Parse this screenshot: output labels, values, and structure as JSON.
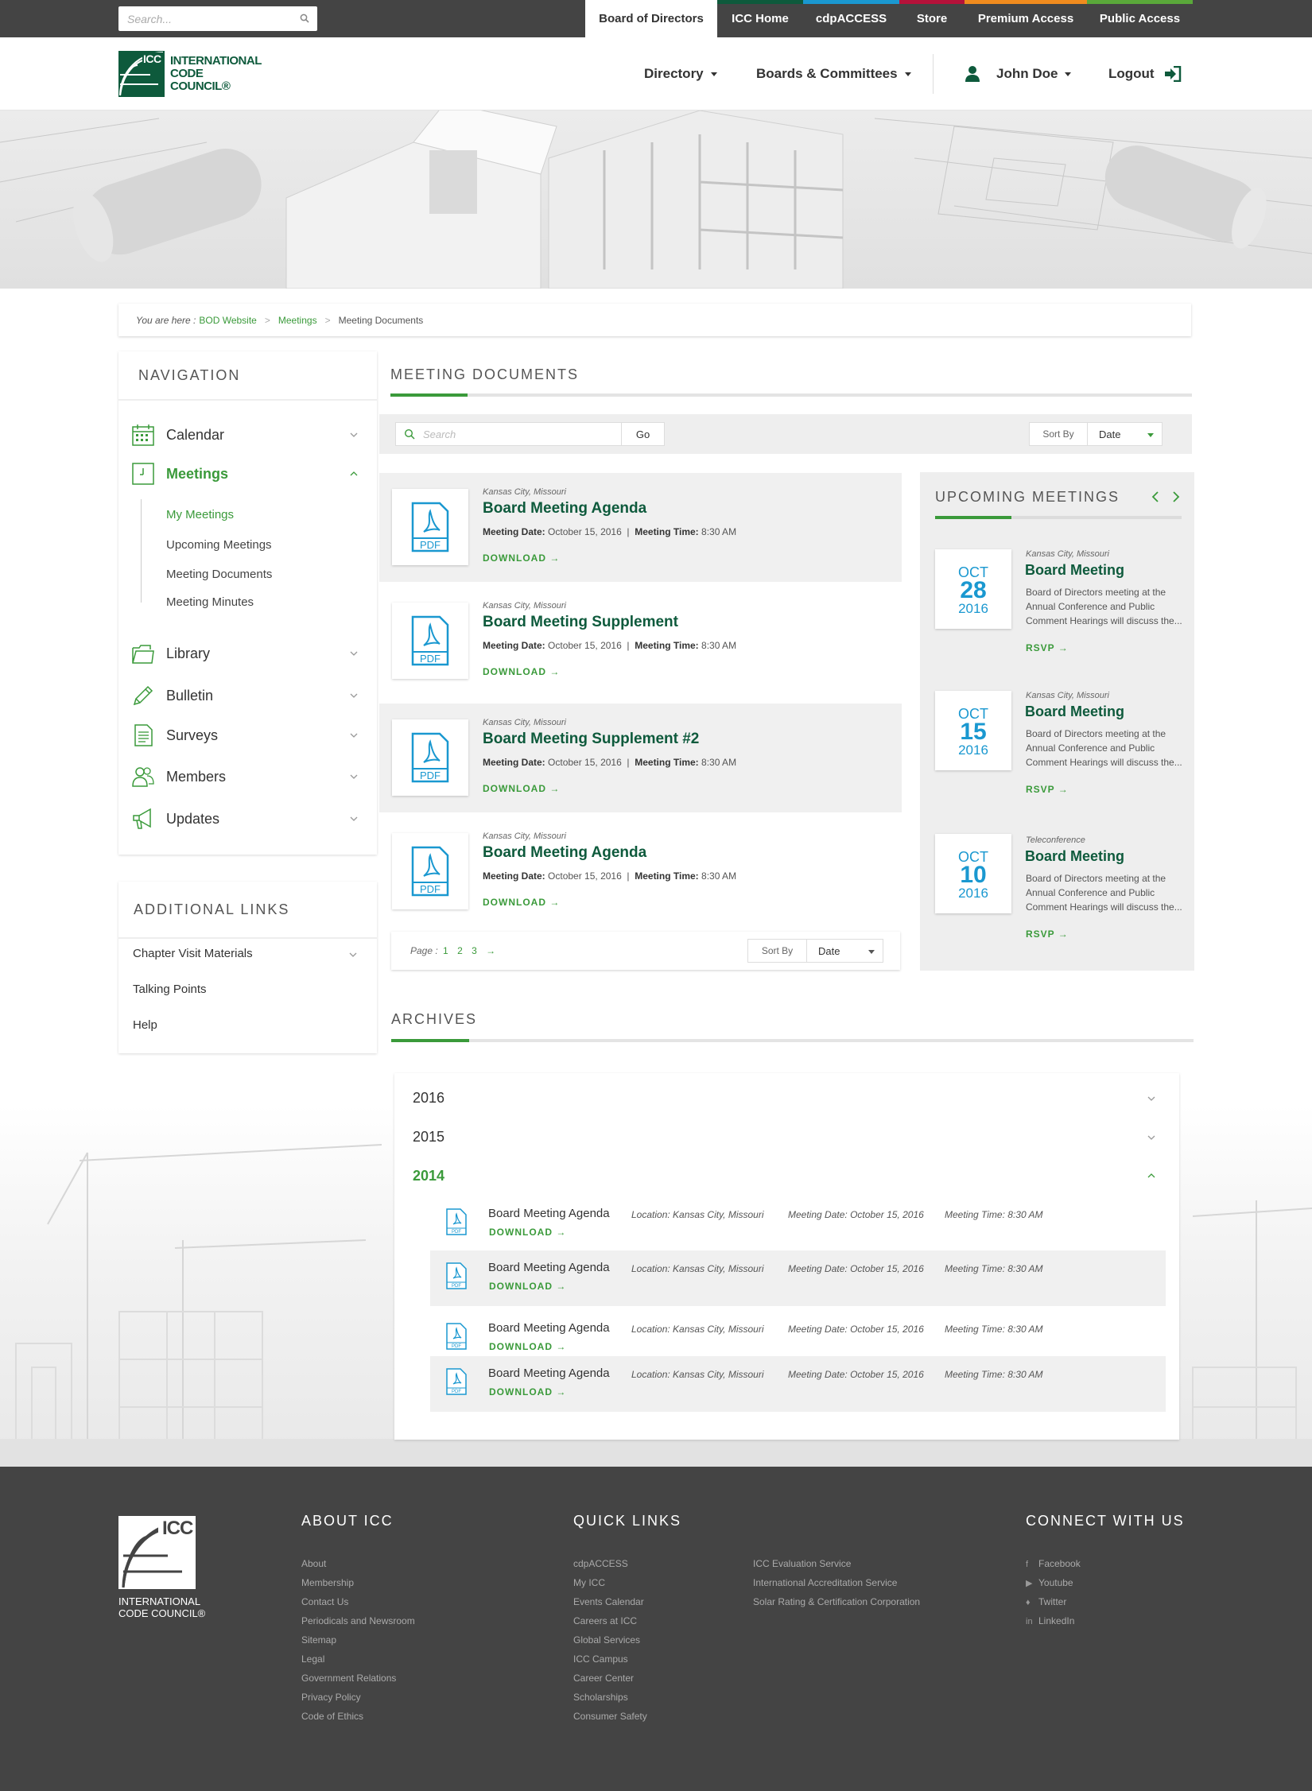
{
  "topbar": {
    "search_placeholder": "Search...",
    "tabs": [
      {
        "label": "Board of Directors",
        "accent": "#ffffff"
      },
      {
        "label": "ICC Home",
        "accent": "#0e5a3c"
      },
      {
        "label": "cdpACCESS",
        "accent": "#1a98d0"
      },
      {
        "label": "Store",
        "accent": "#b5123a"
      },
      {
        "label": "Premium Access",
        "accent": "#f08b1e"
      },
      {
        "label": "Public Access",
        "accent": "#5aa83a"
      }
    ]
  },
  "header": {
    "logo_text": [
      "INTERNATIONAL",
      "CODE",
      "COUNCIL®"
    ],
    "logo_abbr": "ICC",
    "nav": {
      "directory": "Directory",
      "boards": "Boards & Committees",
      "user": "John Doe",
      "logout": "Logout"
    }
  },
  "breadcrumb": {
    "prefix": "You are here :",
    "items": [
      "BOD Website",
      "Meetings",
      "Meeting Documents"
    ]
  },
  "sidebar": {
    "title": "NAVIGATION",
    "items": [
      {
        "label": "Calendar",
        "icon": "calendar-icon"
      },
      {
        "label": "Meetings",
        "icon": "clock-icon",
        "active": true
      },
      {
        "label": "Library",
        "icon": "folder-icon"
      },
      {
        "label": "Bulletin",
        "icon": "pencil-icon"
      },
      {
        "label": "Surveys",
        "icon": "document-icon"
      },
      {
        "label": "Members",
        "icon": "members-icon"
      },
      {
        "label": "Updates",
        "icon": "megaphone-icon"
      }
    ],
    "sub_items": [
      "My Meetings",
      "Upcoming Meetings",
      "Meeting Documents",
      "Meeting Minutes"
    ],
    "links_title": "ADDITIONAL LINKS",
    "links": [
      "Chapter Visit Materials",
      "Talking Points",
      "Help"
    ]
  },
  "main": {
    "title": "MEETING DOCUMENTS",
    "search_placeholder": "Search",
    "go_label": "Go",
    "sort_label": "Sort By",
    "sort_value": "Date",
    "documents": [
      {
        "location": "Kansas City, Missouri",
        "title": "Board Meeting Agenda",
        "date_label": "Meeting Date:",
        "date": "October 15, 2016",
        "time_label": "Meeting Time:",
        "time": "8:30 AM",
        "download": "DOWNLOAD →"
      },
      {
        "location": "Kansas City, Missouri",
        "title": "Board Meeting Supplement",
        "date_label": "Meeting Date:",
        "date": "October 15, 2016",
        "time_label": "Meeting Time:",
        "time": "8:30 AM",
        "download": "DOWNLOAD →"
      },
      {
        "location": "Kansas City, Missouri",
        "title": "Board Meeting Supplement #2",
        "date_label": "Meeting Date:",
        "date": "October 15, 2016",
        "time_label": "Meeting Time:",
        "time": "8:30 AM",
        "download": "DOWNLOAD →"
      },
      {
        "location": "Kansas City, Missouri",
        "title": "Board Meeting Agenda",
        "date_label": "Meeting Date:",
        "date": "October 15, 2016",
        "time_label": "Meeting Time:",
        "time": "8:30 AM",
        "download": "DOWNLOAD →"
      }
    ],
    "pdf_label": "PDF",
    "pager": {
      "label": "Page :",
      "pages": [
        "1",
        "2",
        "3"
      ],
      "next": "→"
    }
  },
  "upcoming": {
    "title": "UPCOMING MEETINGS",
    "events": [
      {
        "month": "OCT",
        "day": "28",
        "year": "2016",
        "location": "Kansas City, Missouri",
        "title": "Board Meeting",
        "desc": "Board of Directors meeting at the Annual Conference and Public Comment Hearings will discuss the...",
        "rsvp": "RSVP →"
      },
      {
        "month": "OCT",
        "day": "15",
        "year": "2016",
        "location": "Kansas City, Missouri",
        "title": "Board Meeting",
        "desc": "Board of Directors meeting at the Annual Conference and Public Comment Hearings will discuss the...",
        "rsvp": "RSVP →"
      },
      {
        "month": "OCT",
        "day": "10",
        "year": "2016",
        "location": "Teleconference",
        "title": "Board Meeting",
        "desc": "Board of Directors meeting at the Annual Conference and Public Comment Hearings will discuss the...",
        "rsvp": "RSVP →"
      }
    ]
  },
  "archives": {
    "title": "ARCHIVES",
    "years": [
      "2016",
      "2015",
      "2014"
    ],
    "open_year": "2014",
    "rows": [
      {
        "name": "Board Meeting Agenda",
        "download": "DOWNLOAD →",
        "loc_label": "Location:",
        "loc": "Kansas City, Missouri",
        "date_label": "Meeting Date:",
        "date": "October 15, 2016",
        "time_label": "Meeting Time:",
        "time": "8:30 AM"
      },
      {
        "name": "Board Meeting Agenda",
        "download": "DOWNLOAD →",
        "loc_label": "Location:",
        "loc": "Kansas City, Missouri",
        "date_label": "Meeting Date:",
        "date": "October 15, 2016",
        "time_label": "Meeting Time:",
        "time": "8:30 AM"
      },
      {
        "name": "Board Meeting Agenda",
        "download": "DOWNLOAD →",
        "loc_label": "Location:",
        "loc": "Kansas City, Missouri",
        "date_label": "Meeting Date:",
        "date": "October 15, 2016",
        "time_label": "Meeting Time:",
        "time": "8:30 AM"
      },
      {
        "name": "Board Meeting Agenda",
        "download": "DOWNLOAD →",
        "loc_label": "Location:",
        "loc": "Kansas City, Missouri",
        "date_label": "Meeting Date:",
        "date": "October 15, 2016",
        "time_label": "Meeting Time:",
        "time": "8:30 AM"
      }
    ]
  },
  "footer": {
    "logo_abbr": "ICC",
    "logo_text": [
      "INTERNATIONAL",
      "CODE COUNCIL®"
    ],
    "about_title": "ABOUT ICC",
    "about_links": [
      "About",
      "Membership",
      "Contact Us",
      "Periodicals and Newsroom",
      "Sitemap",
      "Legal",
      "Government Relations",
      "Privacy Policy",
      "Code of Ethics"
    ],
    "quick_title": "QUICK LINKS",
    "quick_links": [
      "cdpACCESS",
      "My ICC",
      "Events Calendar",
      "Careers at ICC",
      "Global Services",
      "ICC Campus",
      "Career Center",
      "Scholarships",
      "Consumer Safety"
    ],
    "quick_links_2": [
      "ICC Evaluation Service",
      "International Accreditation Service",
      "Solar Rating & Certification Corporation"
    ],
    "connect_title": "CONNECT WITH US",
    "social": [
      {
        "label": "Facebook",
        "icon": "facebook-icon",
        "glyph": "f"
      },
      {
        "label": "Youtube",
        "icon": "youtube-icon",
        "glyph": "▶"
      },
      {
        "label": "Twitter",
        "icon": "twitter-icon",
        "glyph": "♦"
      },
      {
        "label": "LinkedIn",
        "icon": "linkedin-icon",
        "glyph": "in"
      }
    ]
  },
  "colors": {
    "brand_green": "#0e5a3c",
    "accent_green": "#3a9a3a",
    "date_blue": "#1a98d0",
    "topbar": "#444444",
    "footer": "#444444"
  }
}
